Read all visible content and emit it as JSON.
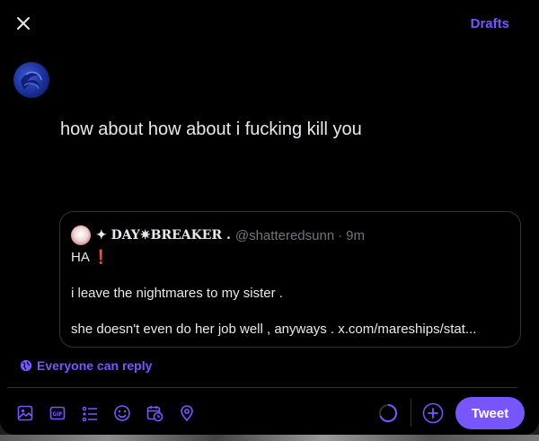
{
  "header": {
    "drafts_label": "Drafts"
  },
  "composer": {
    "text": "how about how about i fucking kill you"
  },
  "quote": {
    "display_name": "✦ DAY✷BREAKER .",
    "handle": "@shatteredsunn",
    "separator": "·",
    "time": "9m",
    "lines": [
      "HA ❗️",
      "i leave the nightmares to my sister .",
      "she doesn't even do her job well ,  anyways . x.com/mareships/stat..."
    ]
  },
  "reply_setting": {
    "label": "Everyone can reply"
  },
  "toolbar": {
    "icons": [
      "image-icon",
      "gif-icon",
      "poll-icon",
      "emoji-icon",
      "schedule-icon",
      "location-icon"
    ],
    "tweet_label": "Tweet"
  },
  "colors": {
    "accent": "#7856ff",
    "background": "#000000",
    "text": "#e7e9ea",
    "muted": "#71767b",
    "border": "#2f3336"
  }
}
